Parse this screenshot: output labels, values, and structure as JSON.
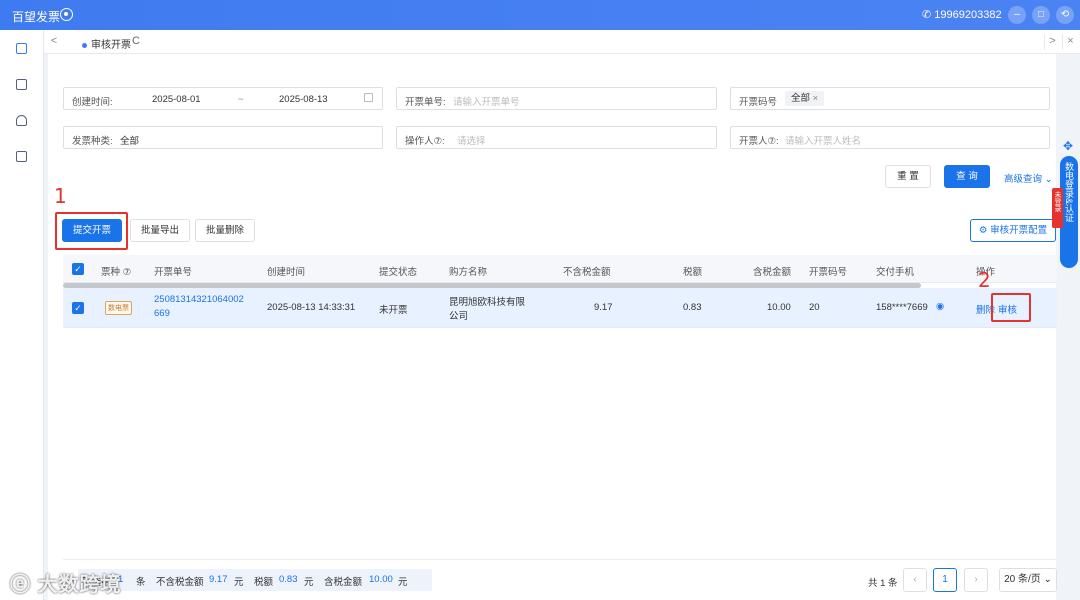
{
  "app": {
    "title": "百望发票",
    "phone": "19969203382",
    "window_buttons": [
      "–",
      "□",
      "⟲"
    ]
  },
  "tabbar": {
    "left_arrow": "<",
    "right_arrow": ">",
    "close": "×",
    "active_tab": "审核开票",
    "refresh_icon": "C"
  },
  "filters": {
    "created_label": "创建时间:",
    "date_start": "2025-08-01",
    "date_sep": "~",
    "date_end": "2025-08-13",
    "invoice_no_label": "开票单号:",
    "invoice_no_placeholder": "请输入开票单号",
    "code_label": "开票码号",
    "code_tag": "全部",
    "type_label": "发票种类:",
    "type_value": "全部",
    "operator_label": "操作人⑦:",
    "operator_placeholder": "请选择",
    "issuer_label": "开票人⑦:",
    "issuer_placeholder": "请输入开票人姓名"
  },
  "actions": {
    "reset": "重 置",
    "query": "查 询",
    "advanced": "高级查询",
    "submit": "提交开票",
    "batch_export": "批量导出",
    "batch_delete": "批量删除",
    "audit_config": "审核开票配置"
  },
  "annotations": {
    "one": "1",
    "two": "2"
  },
  "table": {
    "headers": {
      "type": "票种 ⑦",
      "order_no": "开票单号",
      "created": "创建时间",
      "status": "提交状态",
      "buyer": "购方名称",
      "amount_ex_tax": "不含税金额",
      "tax": "税额",
      "amount_in_tax": "含税金额",
      "code": "开票码号",
      "phone": "交付手机",
      "ops": "操作"
    },
    "rows": [
      {
        "type_badge": "数电票",
        "order_no_line1": "25081314321064002",
        "order_no_line2": "669",
        "created": "2025-08-13 14:33:31",
        "status": "未开票",
        "buyer_line1": "昆明旭欧科技有限",
        "buyer_line2": "公司",
        "amount_ex_tax": "9.17",
        "tax": "0.83",
        "amount_in_tax": "10.00",
        "code": "20",
        "phone": "158****7669",
        "op_delete": "删除",
        "op_audit": "审核"
      }
    ]
  },
  "footer": {
    "summary_prefix": "已选中",
    "summary_count": "1",
    "summary_unit": "条",
    "ex_tax_label": "不含税金额",
    "ex_tax_value": "9.17",
    "ex_tax_unit": "元",
    "tax_label": "税额",
    "tax_value": "0.83",
    "tax_unit": "元",
    "in_tax_label": "含税金额",
    "in_tax_value": "10.00",
    "in_tax_unit": "元",
    "total": "共 1 条",
    "current_page": "1",
    "page_size": "20 条/页"
  },
  "watermark": "大数跨境",
  "side_widget": {
    "text": "数电登录&认证",
    "red_tag": "未登录"
  }
}
